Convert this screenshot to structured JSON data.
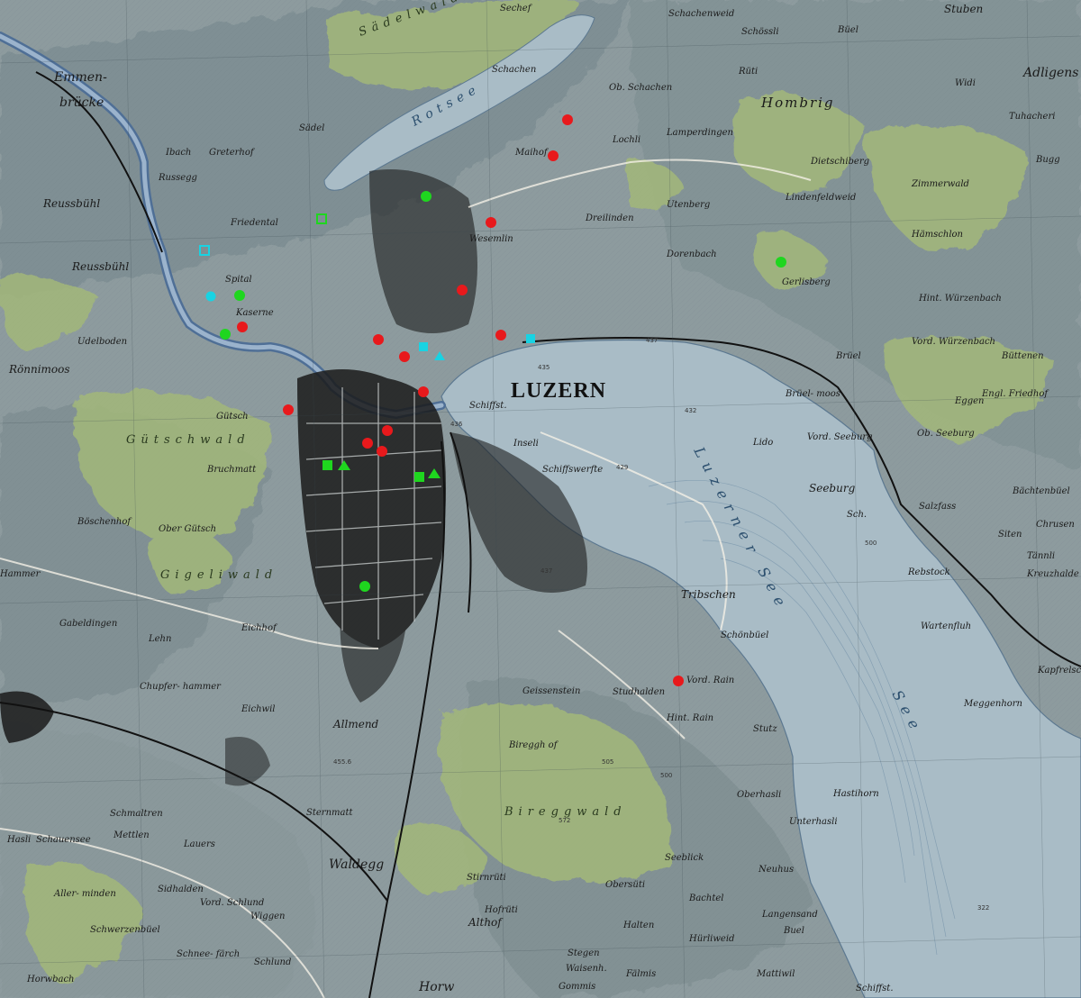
{
  "map": {
    "city": "LUZERN",
    "lakes": [
      "Rotsee",
      "Luzerner See",
      "See"
    ],
    "forests": [
      "Sädelwald",
      "Gütschwald",
      "Bireggwald",
      "Gigeliwald"
    ],
    "places": [
      "Emmen-",
      "brücke",
      "Reussbühl",
      "Reussbühl",
      "Rönnimoos",
      "Gütsch",
      "Bruchmatt",
      "Greterhof",
      "Sädel",
      "Ibach",
      "Russegg",
      "Friedental",
      "Spital",
      "Kaserne",
      "Udelboden",
      "Sechef",
      "Schachen",
      "Maihof",
      "Wesemlin",
      "Dreilinden",
      "Utenberg",
      "Dorenbach",
      "Gerlisberg",
      "Hombrig",
      "Adligens",
      "Stuben",
      "Dietschiberg",
      "Lamperdingen",
      "Lindenfeldweid",
      "Zimmerwald",
      "Hämschlon",
      "Hint. Würzenbach",
      "Vord. Würzenbach",
      "Brüel",
      "Büttenen",
      "Eggen",
      "Engl. Friedhof",
      "Ob. Seeburg",
      "Vord. Seeburg",
      "Seeburg",
      "Bächtenbüel",
      "Siten",
      "Chrusen",
      "Rebstock",
      "Wartenfluh",
      "Meggenhorn",
      "Kapfrelsch",
      "Tribschen",
      "Schönbüel",
      "Vord. Rain",
      "Hint. Rain",
      "Studhalden",
      "Geissenstein",
      "Bireggh of",
      "Allmend",
      "Eichhof",
      "Eichwil",
      "Chupfer- hammer",
      "Gabeldingen",
      "Lehn",
      "Ober Gütsch",
      "Böschenhof",
      "Sternmatt",
      "Waldegg",
      "Horw",
      "Althof",
      "Obersüti",
      "Seeblick",
      "Bachtel",
      "Halten",
      "Hürliweid",
      "Fälmis",
      "Langensand",
      "Buel",
      "Mattiwil",
      "Oberhasli",
      "Unterhasli",
      "Hastihorn",
      "Stutz",
      "Schmaltren",
      "Schwerzenbüel",
      "Schauensee",
      "Mettlen",
      "Lauers",
      "Vord. Schlund",
      "Schlund",
      "Wiggen",
      "Sidhalden",
      "Aller- minden",
      "Hasli",
      "Horwbach",
      "Schnee- färch",
      "Schachenweid",
      "Schössli",
      "Büel",
      "Widi",
      "Tuhacheri",
      "Bugg",
      "Rüti",
      "Ob. Schachen",
      "Lochli",
      "Lido",
      "Brüel- moos",
      "Inseli",
      "Schiffswerfte",
      "Schiffst.",
      "Sch.",
      "Stirnrüti",
      "Hofrüti",
      "Stegen",
      "Waisenh.",
      "Gommis",
      "Hammer",
      "Kreuzhalde",
      "Neuhus",
      "Tännli",
      "Schiffst.",
      "Salzfass"
    ]
  },
  "overlays": {
    "colors": {
      "red": "#e8191c",
      "green": "#1fd61f",
      "cyan": "#18d3e3"
    },
    "legend": {
      "red": "red-circle-marker",
      "green": "green-marker",
      "cyan": "cyan-marker"
    }
  }
}
